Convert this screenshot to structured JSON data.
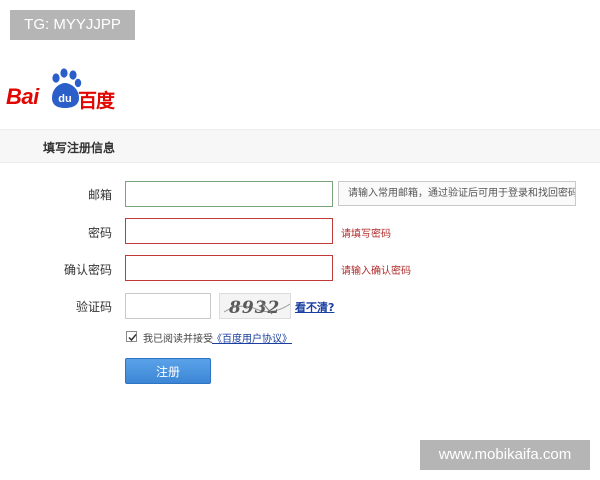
{
  "watermarks": {
    "top": "TG: MYYJJPP",
    "bottom": "www.mobikaifa.com"
  },
  "logo": {
    "latin": "Bai",
    "paw_text": "du",
    "chinese": "百度",
    "brand_color": "#e10601"
  },
  "section": {
    "title": "填写注册信息"
  },
  "form": {
    "email": {
      "label": "邮箱",
      "value": "",
      "hint": "请输入常用邮箱，通过验证后可用于登录和找回密码"
    },
    "password": {
      "label": "密码",
      "value": "",
      "error": "请填写密码"
    },
    "confirm": {
      "label": "确认密码",
      "value": "",
      "error": "请输入确认密码"
    },
    "captcha": {
      "label": "验证码",
      "value": "",
      "image_text": "8932",
      "refresh": "看不清?"
    }
  },
  "agreement": {
    "checked": true,
    "text": "我已阅读并接受",
    "link": "《百度用户协议》"
  },
  "submit": {
    "label": "注册",
    "color": "#4a95e0"
  },
  "colors": {
    "error": "#b02a2a",
    "link": "#1a3fa0"
  }
}
